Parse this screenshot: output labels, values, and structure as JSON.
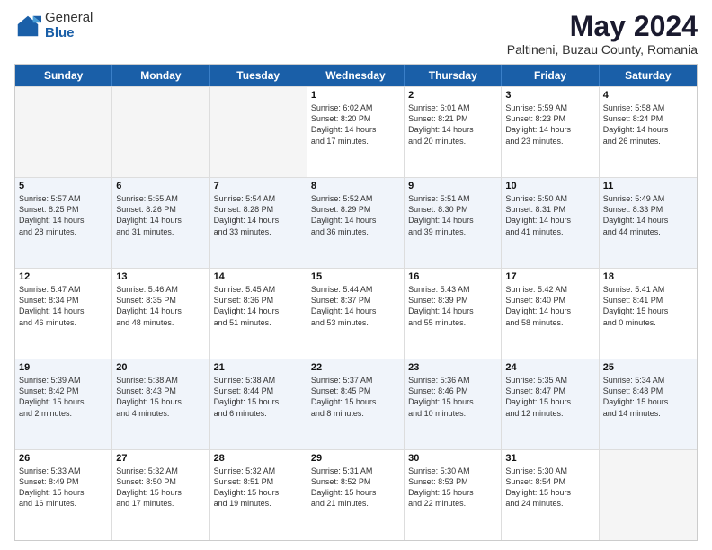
{
  "header": {
    "logo_general": "General",
    "logo_blue": "Blue",
    "month_title": "May 2024",
    "location": "Paltineni, Buzau County, Romania"
  },
  "days_of_week": [
    "Sunday",
    "Monday",
    "Tuesday",
    "Wednesday",
    "Thursday",
    "Friday",
    "Saturday"
  ],
  "weeks": [
    [
      {
        "day": "",
        "info": ""
      },
      {
        "day": "",
        "info": ""
      },
      {
        "day": "",
        "info": ""
      },
      {
        "day": "1",
        "info": "Sunrise: 6:02 AM\nSunset: 8:20 PM\nDaylight: 14 hours\nand 17 minutes."
      },
      {
        "day": "2",
        "info": "Sunrise: 6:01 AM\nSunset: 8:21 PM\nDaylight: 14 hours\nand 20 minutes."
      },
      {
        "day": "3",
        "info": "Sunrise: 5:59 AM\nSunset: 8:23 PM\nDaylight: 14 hours\nand 23 minutes."
      },
      {
        "day": "4",
        "info": "Sunrise: 5:58 AM\nSunset: 8:24 PM\nDaylight: 14 hours\nand 26 minutes."
      }
    ],
    [
      {
        "day": "5",
        "info": "Sunrise: 5:57 AM\nSunset: 8:25 PM\nDaylight: 14 hours\nand 28 minutes."
      },
      {
        "day": "6",
        "info": "Sunrise: 5:55 AM\nSunset: 8:26 PM\nDaylight: 14 hours\nand 31 minutes."
      },
      {
        "day": "7",
        "info": "Sunrise: 5:54 AM\nSunset: 8:28 PM\nDaylight: 14 hours\nand 33 minutes."
      },
      {
        "day": "8",
        "info": "Sunrise: 5:52 AM\nSunset: 8:29 PM\nDaylight: 14 hours\nand 36 minutes."
      },
      {
        "day": "9",
        "info": "Sunrise: 5:51 AM\nSunset: 8:30 PM\nDaylight: 14 hours\nand 39 minutes."
      },
      {
        "day": "10",
        "info": "Sunrise: 5:50 AM\nSunset: 8:31 PM\nDaylight: 14 hours\nand 41 minutes."
      },
      {
        "day": "11",
        "info": "Sunrise: 5:49 AM\nSunset: 8:33 PM\nDaylight: 14 hours\nand 44 minutes."
      }
    ],
    [
      {
        "day": "12",
        "info": "Sunrise: 5:47 AM\nSunset: 8:34 PM\nDaylight: 14 hours\nand 46 minutes."
      },
      {
        "day": "13",
        "info": "Sunrise: 5:46 AM\nSunset: 8:35 PM\nDaylight: 14 hours\nand 48 minutes."
      },
      {
        "day": "14",
        "info": "Sunrise: 5:45 AM\nSunset: 8:36 PM\nDaylight: 14 hours\nand 51 minutes."
      },
      {
        "day": "15",
        "info": "Sunrise: 5:44 AM\nSunset: 8:37 PM\nDaylight: 14 hours\nand 53 minutes."
      },
      {
        "day": "16",
        "info": "Sunrise: 5:43 AM\nSunset: 8:39 PM\nDaylight: 14 hours\nand 55 minutes."
      },
      {
        "day": "17",
        "info": "Sunrise: 5:42 AM\nSunset: 8:40 PM\nDaylight: 14 hours\nand 58 minutes."
      },
      {
        "day": "18",
        "info": "Sunrise: 5:41 AM\nSunset: 8:41 PM\nDaylight: 15 hours\nand 0 minutes."
      }
    ],
    [
      {
        "day": "19",
        "info": "Sunrise: 5:39 AM\nSunset: 8:42 PM\nDaylight: 15 hours\nand 2 minutes."
      },
      {
        "day": "20",
        "info": "Sunrise: 5:38 AM\nSunset: 8:43 PM\nDaylight: 15 hours\nand 4 minutes."
      },
      {
        "day": "21",
        "info": "Sunrise: 5:38 AM\nSunset: 8:44 PM\nDaylight: 15 hours\nand 6 minutes."
      },
      {
        "day": "22",
        "info": "Sunrise: 5:37 AM\nSunset: 8:45 PM\nDaylight: 15 hours\nand 8 minutes."
      },
      {
        "day": "23",
        "info": "Sunrise: 5:36 AM\nSunset: 8:46 PM\nDaylight: 15 hours\nand 10 minutes."
      },
      {
        "day": "24",
        "info": "Sunrise: 5:35 AM\nSunset: 8:47 PM\nDaylight: 15 hours\nand 12 minutes."
      },
      {
        "day": "25",
        "info": "Sunrise: 5:34 AM\nSunset: 8:48 PM\nDaylight: 15 hours\nand 14 minutes."
      }
    ],
    [
      {
        "day": "26",
        "info": "Sunrise: 5:33 AM\nSunset: 8:49 PM\nDaylight: 15 hours\nand 16 minutes."
      },
      {
        "day": "27",
        "info": "Sunrise: 5:32 AM\nSunset: 8:50 PM\nDaylight: 15 hours\nand 17 minutes."
      },
      {
        "day": "28",
        "info": "Sunrise: 5:32 AM\nSunset: 8:51 PM\nDaylight: 15 hours\nand 19 minutes."
      },
      {
        "day": "29",
        "info": "Sunrise: 5:31 AM\nSunset: 8:52 PM\nDaylight: 15 hours\nand 21 minutes."
      },
      {
        "day": "30",
        "info": "Sunrise: 5:30 AM\nSunset: 8:53 PM\nDaylight: 15 hours\nand 22 minutes."
      },
      {
        "day": "31",
        "info": "Sunrise: 5:30 AM\nSunset: 8:54 PM\nDaylight: 15 hours\nand 24 minutes."
      },
      {
        "day": "",
        "info": ""
      }
    ]
  ]
}
